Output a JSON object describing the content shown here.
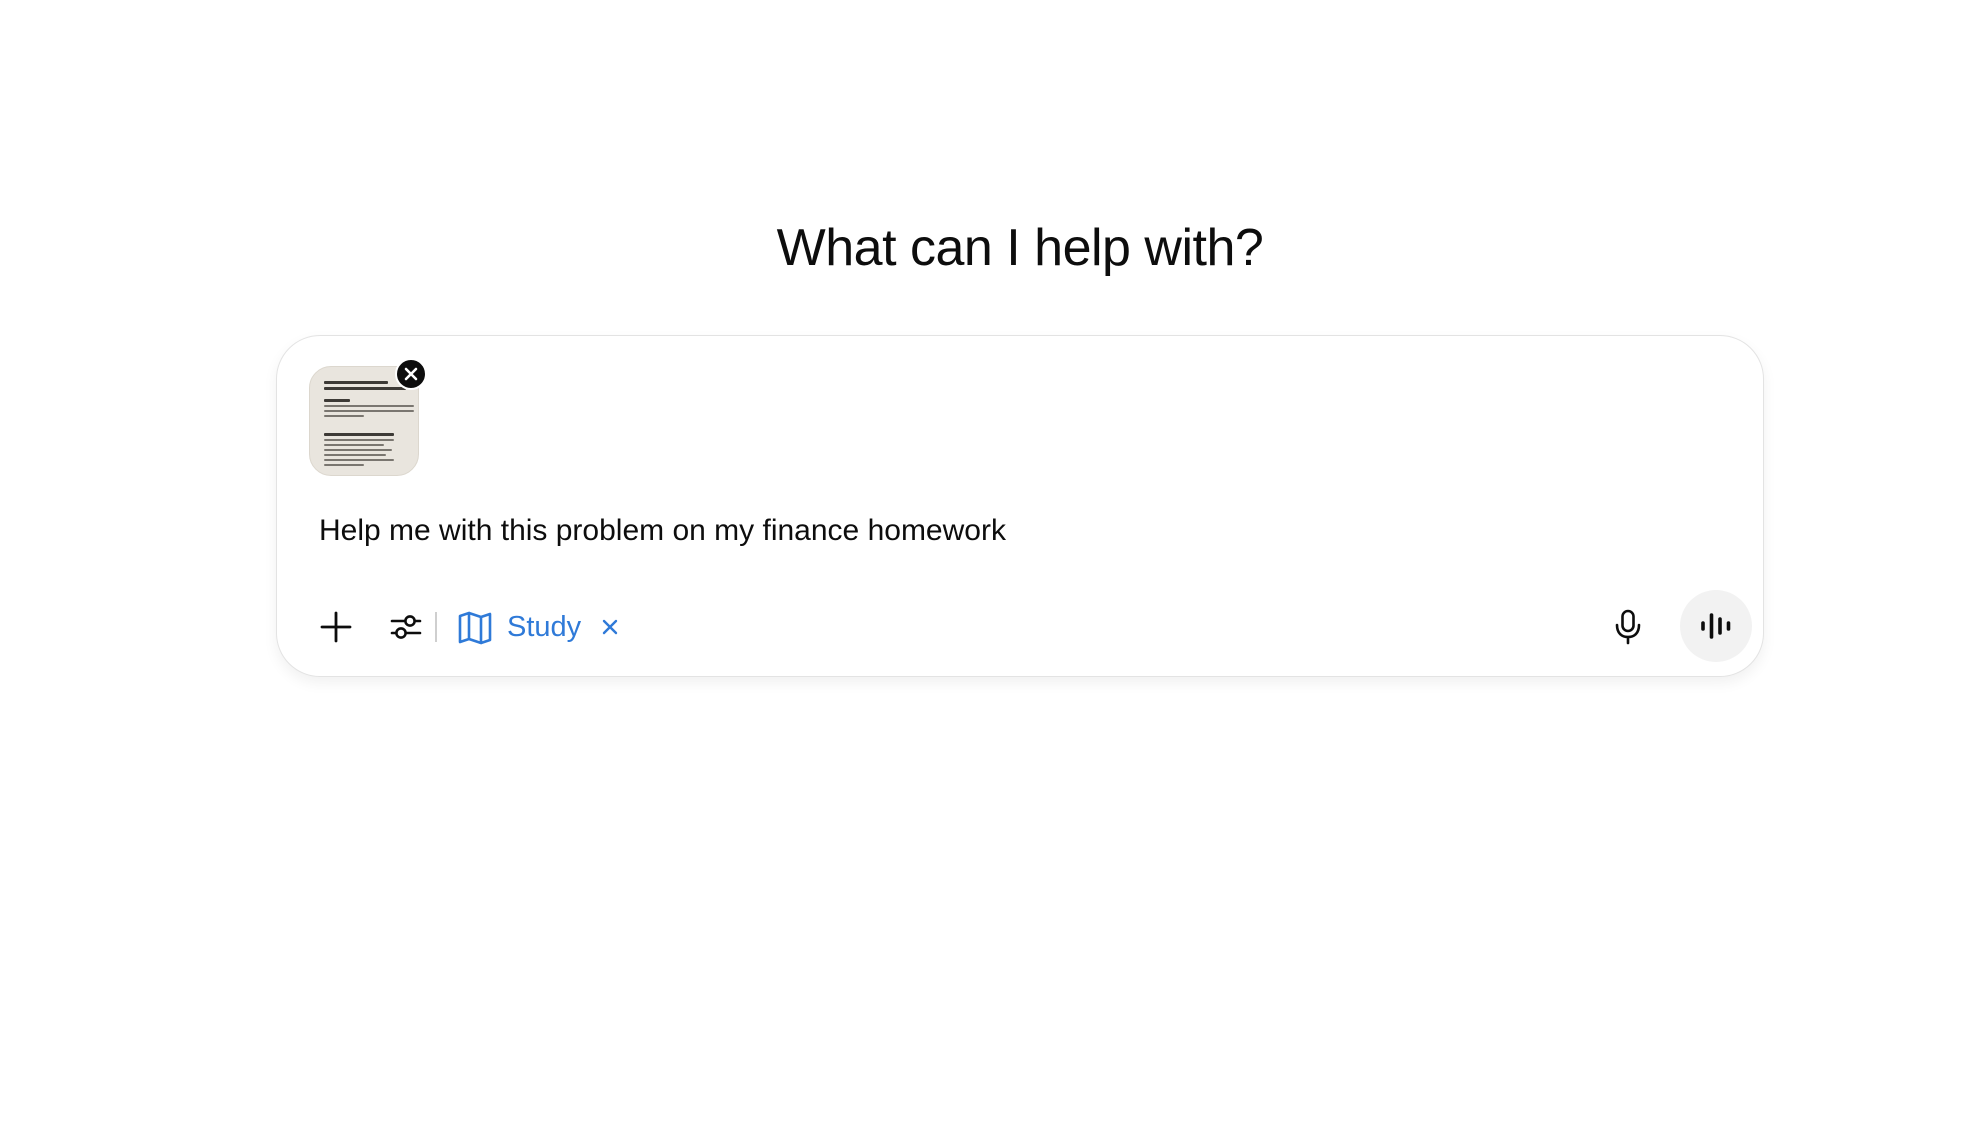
{
  "heading": "What can I help with?",
  "composer": {
    "attachment": {
      "kind": "image",
      "icon": "close-icon"
    },
    "prompt_text": "Help me with this problem on my finance homework",
    "toolbar": {
      "add_icon": "plus-icon",
      "tools_icon": "sliders-icon",
      "study_chip": {
        "label": "Study",
        "icon": "book-icon",
        "remove_icon": "close-icon",
        "color": "#2f7ad8"
      },
      "mic_icon": "microphone-icon",
      "voice_icon": "voice-waveform-icon"
    }
  }
}
